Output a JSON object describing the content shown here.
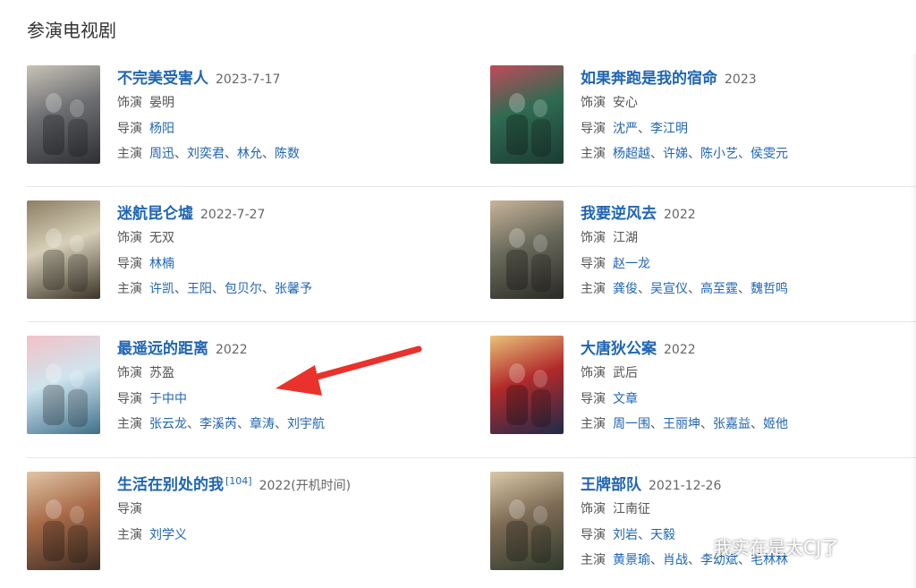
{
  "section_title": "参演电视剧",
  "labels": {
    "role": "饰演",
    "director": "导演",
    "cast": "主演"
  },
  "separator": "、",
  "dramas": [
    {
      "title": "不完美受害人",
      "note": "",
      "year": "2023-7-17",
      "role": "晏明",
      "directors": [
        "杨阳"
      ],
      "cast": [
        "周迅",
        "刘奕君",
        "林允",
        "陈数"
      ],
      "poster_colors": [
        "#6d6f72",
        "#c9c3b8",
        "#2e2f33"
      ]
    },
    {
      "title": "如果奔跑是我的宿命",
      "note": "",
      "year": "2023",
      "role": "安心",
      "directors": [
        "沈严",
        "李江明"
      ],
      "cast": [
        "杨超越",
        "许娣",
        "陈小艺",
        "侯雯元"
      ],
      "poster_colors": [
        "#2f6b52",
        "#c04a5a",
        "#1c3a33"
      ]
    },
    {
      "title": "迷航昆仑墟",
      "note": "",
      "year": "2022-7-27",
      "role": "无双",
      "directors": [
        "林楠"
      ],
      "cast": [
        "许凯",
        "王阳",
        "包贝尔",
        "张馨予"
      ],
      "poster_colors": [
        "#d7cfb8",
        "#8c7f64",
        "#3a3428"
      ]
    },
    {
      "title": "我要逆风去",
      "note": "",
      "year": "2022",
      "role": "江湖",
      "directors": [
        "赵一龙"
      ],
      "cast": [
        "龚俊",
        "吴宣仪",
        "高至霆",
        "魏哲鸣"
      ],
      "poster_colors": [
        "#6a6a5c",
        "#c8b49a",
        "#2a2a26"
      ]
    },
    {
      "title": "最遥远的距离",
      "note": "",
      "year": "2022",
      "role": "苏盈",
      "directors": [
        "于中中"
      ],
      "cast": [
        "张云龙",
        "李溪芮",
        "章涛",
        "刘宇航"
      ],
      "poster_colors": [
        "#cfe4ee",
        "#f2c2c6",
        "#3f6f8a"
      ]
    },
    {
      "title": "大唐狄公案",
      "note": "",
      "year": "2022",
      "role": "武后",
      "directors": [
        "文章"
      ],
      "cast": [
        "周一围",
        "王丽坤",
        "张嘉益",
        "姬他"
      ],
      "poster_colors": [
        "#b22a2a",
        "#e8c27a",
        "#1e2a4a"
      ]
    },
    {
      "title": "生活在别处的我",
      "note": "[104]",
      "year": "2022(开机时间)",
      "role": "",
      "directors": [
        "刘学义"
      ],
      "cast": [],
      "poster_colors": [
        "#a86a48",
        "#e0c5a4",
        "#3b2c24"
      ]
    },
    {
      "title": "王牌部队",
      "note": "",
      "year": "2021-12-26",
      "role": "江南征",
      "directors": [
        "刘岩",
        "天毅"
      ],
      "cast": [
        "黄景瑜",
        "肖战",
        "李幼斌",
        "毛林林"
      ],
      "poster_colors": [
        "#7d6b55",
        "#d9c9a8",
        "#2f3a2c"
      ]
    }
  ],
  "watermark": {
    "text": "我实在是太CJ了",
    "icon": "wechat-icon"
  },
  "annotation": {
    "icon": "red-arrow-icon",
    "color": "#e8322b"
  },
  "colors": {
    "link": "#1f65b3",
    "divider": "#e6e6e6"
  }
}
